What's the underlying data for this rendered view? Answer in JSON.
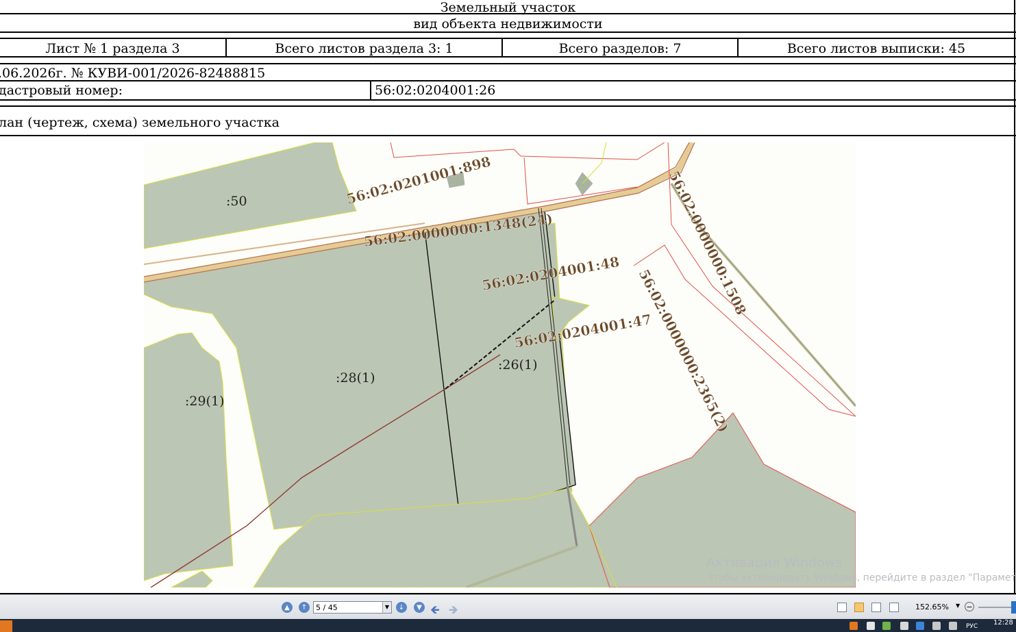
{
  "document": {
    "header_title": "Земельный участок",
    "header_subtitle": "вид объекта недвижимости",
    "sheet_cells": [
      "Лист № 1 раздела 3",
      "Всего листов раздела 3: 1",
      "Всего разделов: 7",
      "Всего листов выписки: 45"
    ],
    "date_number": ".06.2026г. № КУВИ-001/2026-82488815",
    "cadastral_label": "дастровый номер:",
    "cadastral_value": "56:02:0204001:26",
    "plan_label": "лан (чертеж, схема) земельного участка"
  },
  "map": {
    "labels": {
      "p50": ":50",
      "p28": ":28(1)",
      "p29": ":29(1)",
      "p26": ":26(1)",
      "c898": "56:02:0201001:898",
      "c1348": "56:02:0000000:1348(24)",
      "c48": "56:02:0204001:48",
      "c47": "56:02:0204001:47",
      "c1508": "56:02:0000000:1508",
      "c2365": "56:02:0000000:2365(2)"
    },
    "colors": {
      "parcel": "#bcc6b4",
      "label": "#6b4a2a",
      "boundary_red": "#e0504a",
      "boundary_yellow": "#d8e03a"
    }
  },
  "watermark": {
    "line1": "Активация Windows",
    "line2": "Чтобы активировать Windows, перейдите в раздел \"Параметры\"."
  },
  "toolbar": {
    "page_value": "5 / 45",
    "zoom": "152.65%"
  },
  "taskbar": {
    "lang": "РУС",
    "time": "12:28"
  }
}
